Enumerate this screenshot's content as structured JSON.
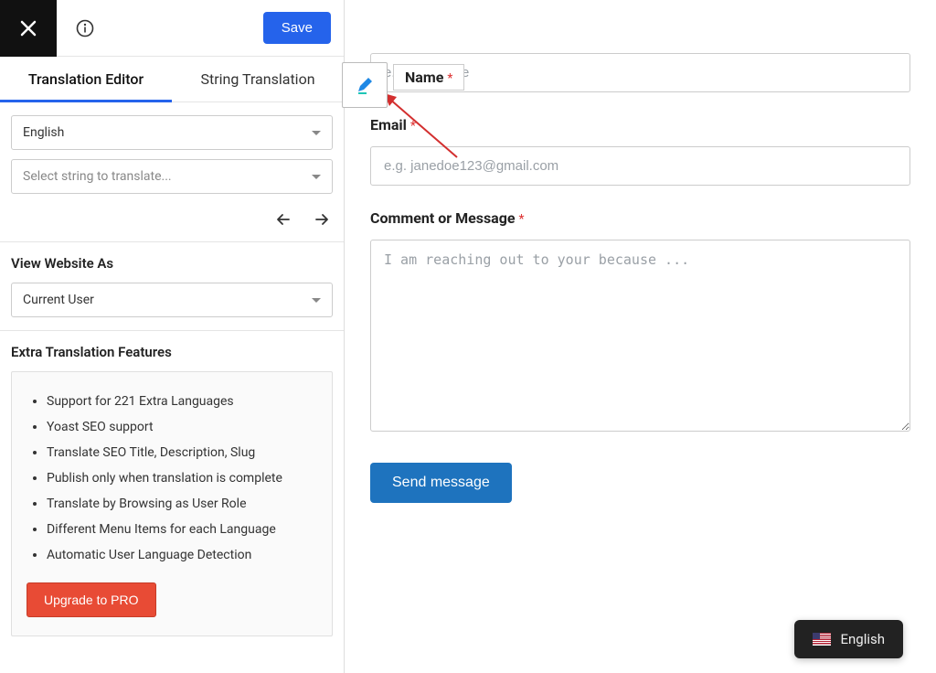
{
  "topbar": {
    "save_label": "Save"
  },
  "tabs": {
    "editor": "Translation Editor",
    "string": "String Translation"
  },
  "lang_select": {
    "value": "English"
  },
  "string_select": {
    "placeholder": "Select string to translate..."
  },
  "view_as": {
    "title": "View Website As",
    "value": "Current User"
  },
  "features": {
    "title": "Extra Translation Features",
    "items": [
      "Support for 221 Extra Languages",
      "Yoast SEO support",
      "Translate SEO Title, Description, Slug",
      "Publish only when translation is complete",
      "Translate by Browsing as User Role",
      "Different Menu Items for each Language",
      "Automatic User Language Detection"
    ],
    "upgrade_label": "Upgrade to PRO"
  },
  "form": {
    "name_label": "Name",
    "name_placeholder": "e.g. Jane Doe",
    "email_label": "Email",
    "email_placeholder": "e.g. janedoe123@gmail.com",
    "message_label": "Comment or Message",
    "message_placeholder": "I am reaching out to your because ...",
    "submit_label": "Send message"
  },
  "lang_badge": {
    "label": "English"
  }
}
